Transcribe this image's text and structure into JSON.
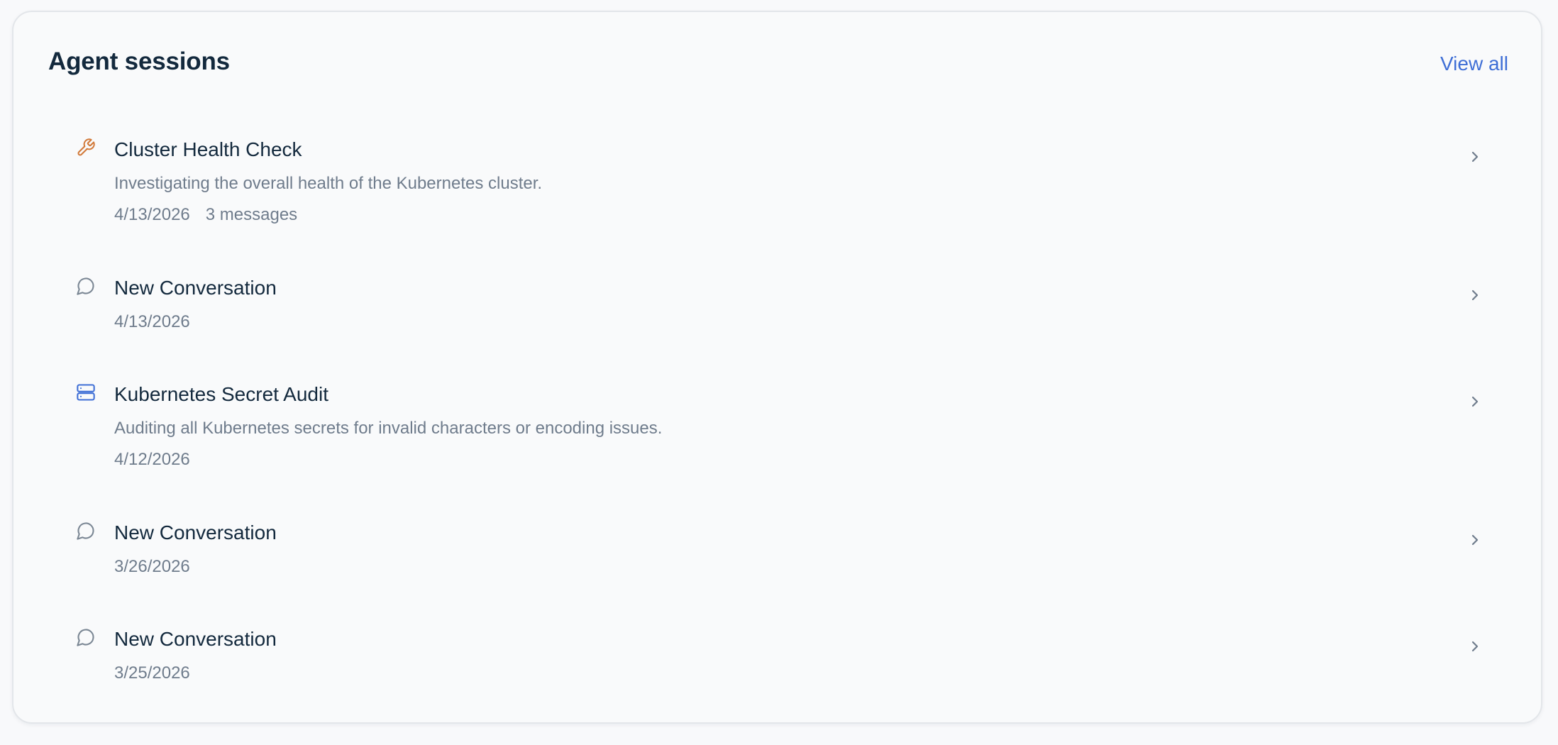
{
  "header": {
    "title": "Agent sessions",
    "view_all_label": "View all"
  },
  "colors": {
    "accent": "#3f6fd6",
    "title": "#13293d",
    "muted": "#6f7c8c",
    "wrench_icon": "#d27a3a",
    "server_icon": "#3f6fd6",
    "chat_icon": "#7b8794"
  },
  "sessions": [
    {
      "icon": "wrench-icon",
      "title": "Cluster Health Check",
      "description": "Investigating the overall health of the Kubernetes cluster.",
      "date": "4/13/2026",
      "messages": "3 messages"
    },
    {
      "icon": "chat-bubble-icon",
      "title": "New Conversation",
      "date": "4/13/2026"
    },
    {
      "icon": "server-icon",
      "title": "Kubernetes Secret Audit",
      "description": "Auditing all Kubernetes secrets for invalid characters or encoding issues.",
      "date": "4/12/2026"
    },
    {
      "icon": "chat-bubble-icon",
      "title": "New Conversation",
      "date": "3/26/2026"
    },
    {
      "icon": "chat-bubble-icon",
      "title": "New Conversation",
      "date": "3/25/2026"
    }
  ]
}
